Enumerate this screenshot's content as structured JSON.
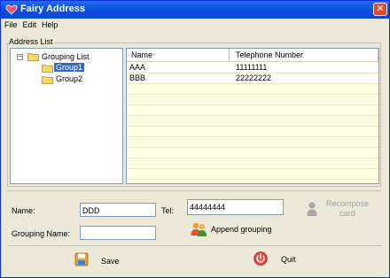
{
  "window": {
    "title": "Fairy Address",
    "close_glyph": "✕"
  },
  "menu": [
    {
      "label": "File"
    },
    {
      "label": "Edit"
    },
    {
      "label": "Help"
    }
  ],
  "address_list": {
    "group_label": "Address List",
    "tree": {
      "root": {
        "label": "Grouping List",
        "expander": "−"
      },
      "children": [
        {
          "label": "Group1",
          "selected": true
        },
        {
          "label": "Group2",
          "selected": false
        }
      ]
    },
    "columns": [
      "Name",
      "Telephone Number"
    ],
    "rows": [
      {
        "name": "AAA",
        "phone": "11111111"
      },
      {
        "name": "BBB",
        "phone": "22222222"
      }
    ]
  },
  "form": {
    "name_label": "Name:",
    "name_value": "DDD",
    "tel_label": "Tel:",
    "tel_value": "44444444",
    "grouping_label": "Grouping Name:",
    "grouping_value": "",
    "recompose_label": "Recompose card",
    "append_label": "Append grouping"
  },
  "actions": {
    "save_label": "Save",
    "quit_label": "Quit"
  },
  "colors": {
    "titlebar": "#0a54e3",
    "selection": "#316ac5",
    "list_background": "#fffde4",
    "window_background": "#ece9d8"
  },
  "icons": {
    "app": "heart-icon",
    "folder": "folder-icon",
    "recompose": "person-icon",
    "append": "users-icon",
    "save": "save-icon",
    "quit": "power-icon"
  }
}
